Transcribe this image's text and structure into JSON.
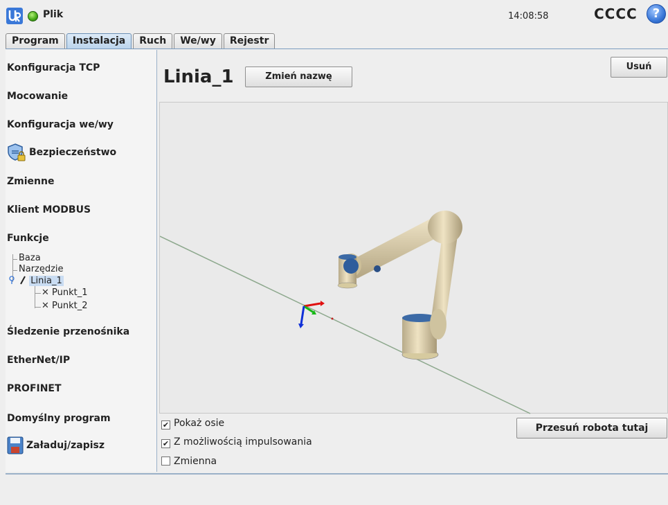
{
  "header": {
    "file_menu": "Plik",
    "time": "14:08:58",
    "robot_name": "CCCC",
    "help": "?"
  },
  "tabs": [
    {
      "label": "Program"
    },
    {
      "label": "Instalacja"
    },
    {
      "label": "Ruch"
    },
    {
      "label": "We/wy"
    },
    {
      "label": "Rejestr"
    }
  ],
  "active_tab": "Instalacja",
  "sidebar": {
    "items": [
      {
        "label": "Konfiguracja TCP"
      },
      {
        "label": "Mocowanie"
      },
      {
        "label": "Konfiguracja we/wy"
      },
      {
        "label": "Bezpieczeństwo",
        "icon": "shield-lock-icon"
      },
      {
        "label": "Zmienne"
      },
      {
        "label": "Klient MODBUS"
      },
      {
        "label": "Funkcje"
      },
      {
        "label": "Śledzenie przenośnika"
      },
      {
        "label": "EtherNet/IP"
      },
      {
        "label": "PROFINET"
      },
      {
        "label": "Domyślny program"
      },
      {
        "label": "Załaduj/zapisz",
        "icon": "save-icon"
      }
    ],
    "tree": {
      "baza": "Baza",
      "narzedzie": "Narzędzie",
      "linia": "Linia_1",
      "punkt1": "Punkt_1",
      "punkt2": "Punkt_2"
    }
  },
  "main": {
    "title": "Linia_1",
    "rename_button": "Zmień nazwę",
    "delete_button": "Usuń",
    "move_button": "Przesuń robota tutaj",
    "options": [
      {
        "label": "Pokaż osie",
        "checked": true
      },
      {
        "label": "Z możliwością impulsowania",
        "checked": true
      },
      {
        "label": "Zmienna",
        "checked": false
      }
    ]
  },
  "colors": {
    "accent": "#3a78d8",
    "selection": "#c9dcf2",
    "status_ok": "#4cae1c"
  }
}
